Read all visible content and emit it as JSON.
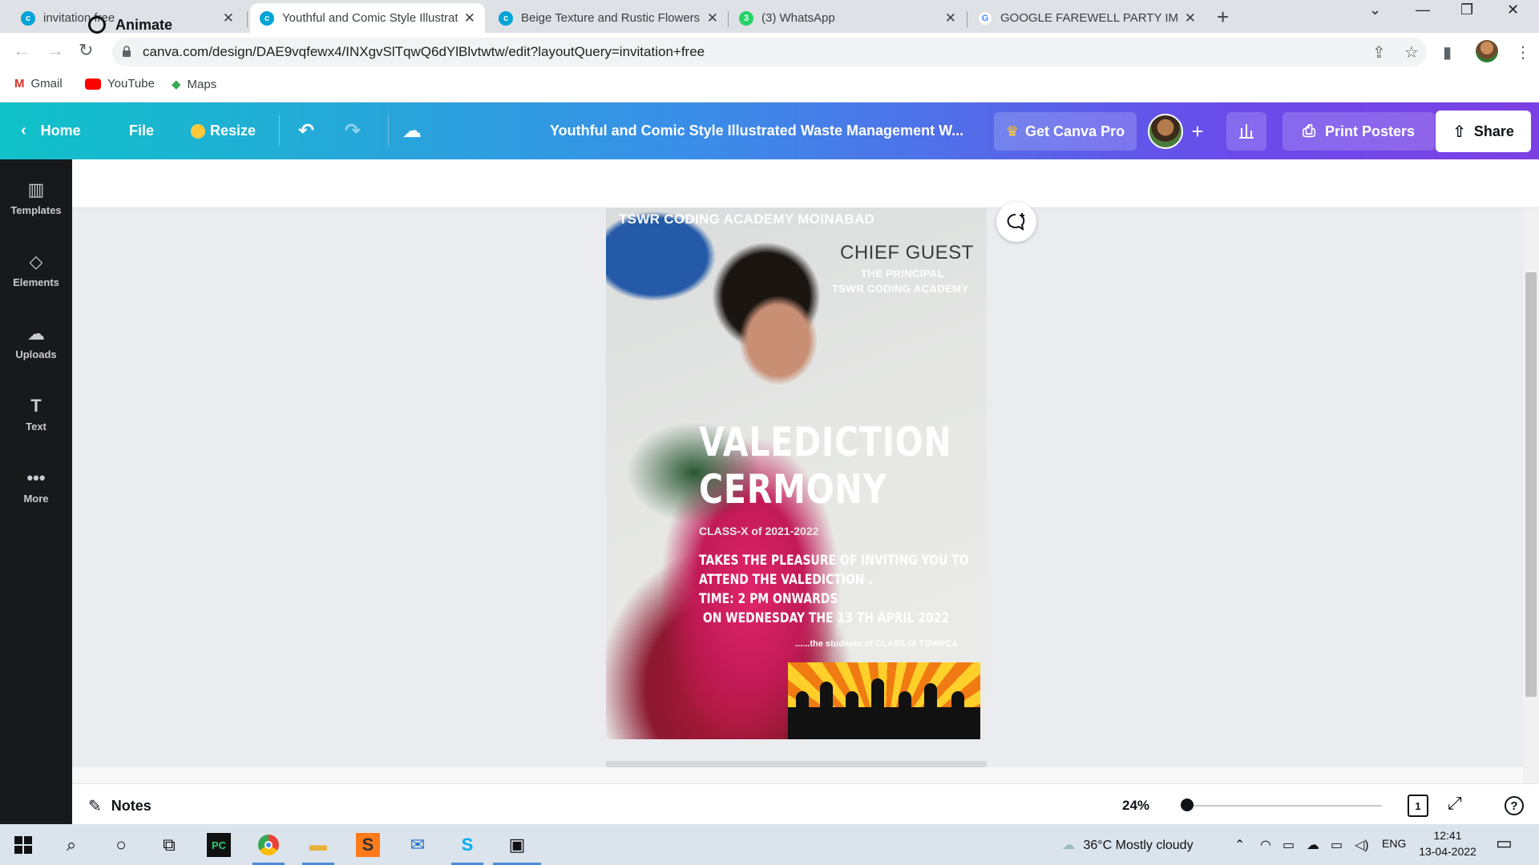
{
  "browser": {
    "tabs": [
      {
        "title": "invitation free",
        "icon": "canva-icon",
        "color": "#00a3d7"
      },
      {
        "title": "Youthful and Comic Style Illustrat",
        "icon": "canva-icon",
        "color": "#00a3d7",
        "active": true
      },
      {
        "title": "Beige Texture and Rustic Flowers",
        "icon": "canva-icon",
        "color": "#00a3d7"
      },
      {
        "title": "(3) WhatsApp",
        "icon": "whatsapp-icon",
        "color": "#25d366",
        "badge": "3"
      },
      {
        "title": "GOOGLE FAREWELL PARTY IMAG",
        "icon": "google-icon",
        "color": "#4285f4"
      }
    ],
    "url": "canva.com/design/DAE9vqfewx4/INXgvSlTqwQ6dYlBlvtwtw/edit?layoutQuery=invitation+free",
    "bookmarks": [
      {
        "label": "Gmail",
        "icon": "gmail-icon"
      },
      {
        "label": "YouTube",
        "icon": "youtube-icon"
      },
      {
        "label": "Maps",
        "icon": "maps-icon"
      }
    ]
  },
  "canva": {
    "header": {
      "home": "Home",
      "file": "File",
      "resize": "Resize",
      "design_title": "Youthful and Comic Style Illustrated Waste Management W...",
      "get_pro": "Get Canva Pro",
      "print": "Print Posters",
      "share": "Share"
    },
    "sidebar": [
      {
        "label": "Templates",
        "icon": "templates-icon"
      },
      {
        "label": "Elements",
        "icon": "elements-icon"
      },
      {
        "label": "Uploads",
        "icon": "uploads-icon"
      },
      {
        "label": "Text",
        "icon": "text-icon"
      },
      {
        "label": "More",
        "icon": "more-icon"
      }
    ],
    "animate": "Animate",
    "notes": "Notes",
    "zoom": "24%",
    "page_number": "1",
    "help": "?"
  },
  "poster": {
    "academy": "TSWR CODING ACADEMY MOINABAD",
    "chief_guest": "CHIEF GUEST",
    "principal": "THE PRINCIPAL",
    "academy_short": "TSWR CODING ACADEMY",
    "title_line1": "VALEDICTION",
    "title_line2": "CERMONY",
    "class_line": "CLASS-X of 2021-2022",
    "body_line1": "TAKES THE PLEASURE OF INVITING YOU TO",
    "body_line2": "ATTEND THE VALEDICTION .",
    "body_line3": "TIME: 2 PM ONWARDS",
    "body_line4": " ON WEDNESDAY THE 13 TH APRIL 2022",
    "students": "......the students of CLASS-IX TSWRCA"
  },
  "taskbar": {
    "weather": "36°C  Mostly cloudy",
    "lang": "ENG",
    "time": "12:41",
    "date": "13-04-2022"
  }
}
